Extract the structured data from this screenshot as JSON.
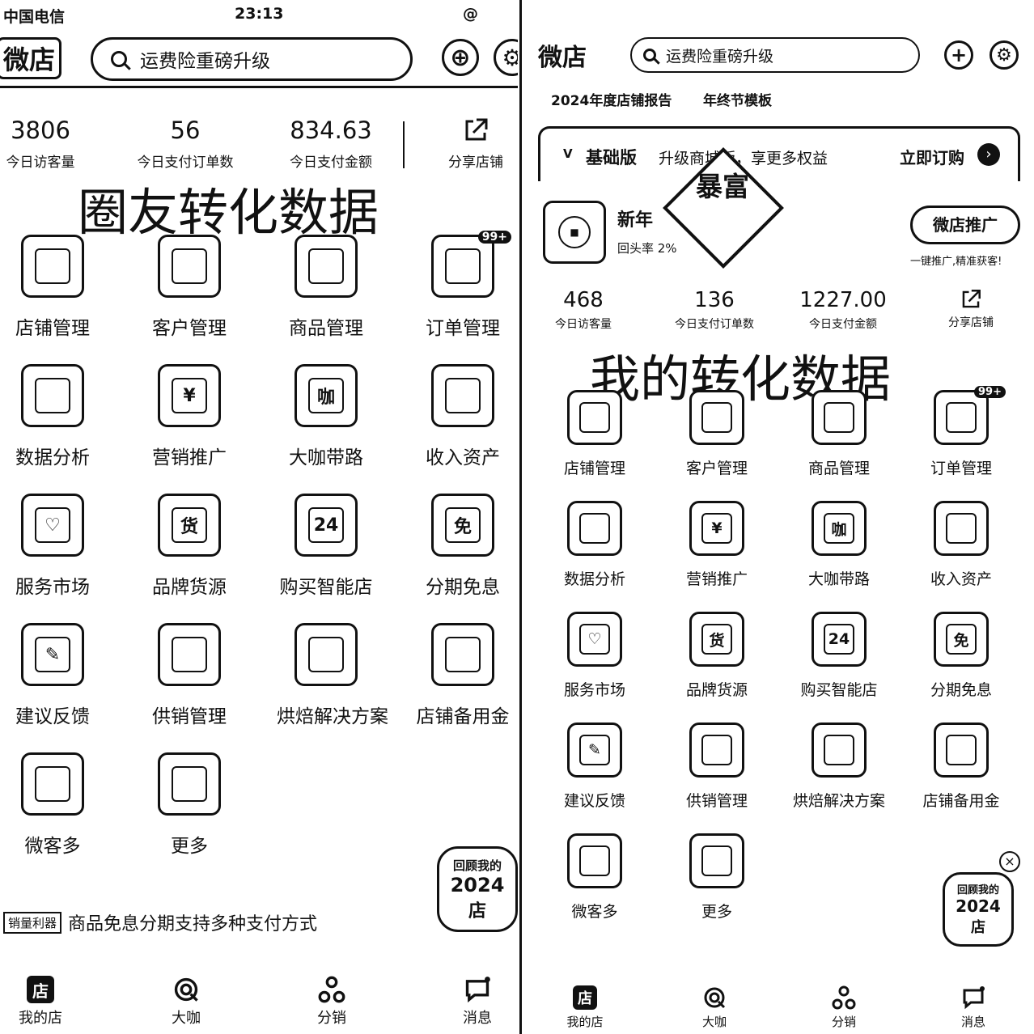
{
  "left": {
    "status": {
      "carrier": "中国电信",
      "time": "23:13",
      "right_icons": "@"
    },
    "header": {
      "logo": "微店",
      "search_placeholder": "运费险重磅升级"
    },
    "stats": [
      {
        "value": "3806",
        "label": "今日访客量"
      },
      {
        "value": "56",
        "label": "今日支付订单数"
      },
      {
        "value": "834.63",
        "label": "今日支付金额"
      }
    ],
    "share_label": "分享店铺",
    "overlay_title": "圈友转化数据",
    "grid": [
      {
        "label": "店铺管理",
        "glyph": ""
      },
      {
        "label": "客户管理",
        "glyph": ""
      },
      {
        "label": "商品管理",
        "glyph": ""
      },
      {
        "label": "订单管理",
        "glyph": "",
        "badge": "99+"
      },
      {
        "label": "数据分析",
        "glyph": ""
      },
      {
        "label": "营销推广",
        "glyph": "¥"
      },
      {
        "label": "大咖带路",
        "glyph": "咖"
      },
      {
        "label": "收入资产",
        "glyph": ""
      },
      {
        "label": "服务市场",
        "glyph": "♡"
      },
      {
        "label": "品牌货源",
        "glyph": "货"
      },
      {
        "label": "购买智能店",
        "glyph": "24"
      },
      {
        "label": "分期免息",
        "glyph": "免"
      },
      {
        "label": "建议反馈",
        "glyph": "✎"
      },
      {
        "label": "供销管理",
        "glyph": ""
      },
      {
        "label": "烘焙解决方案",
        "glyph": ""
      },
      {
        "label": "店铺备用金",
        "glyph": ""
      },
      {
        "label": "微客多",
        "glyph": ""
      },
      {
        "label": "更多",
        "glyph": ""
      }
    ],
    "promo_tag": "销量利器",
    "promo_text": "商品免息分期支持多种支付方式",
    "float_badge": [
      "回顾我的",
      "2024",
      "店"
    ],
    "tabs": [
      {
        "label": "我的店",
        "icon": "店"
      },
      {
        "label": "大咖",
        "icon": ""
      },
      {
        "label": "分销",
        "icon": ""
      },
      {
        "label": "消息",
        "icon": ""
      }
    ]
  },
  "right": {
    "header": {
      "logo": "微店",
      "search_placeholder": "运费险重磅升级"
    },
    "sub_banner": [
      "2024年度店铺报告",
      "年终节模板"
    ],
    "upgrade": {
      "tier": "基础版",
      "text": "升级商城版，享更多权益",
      "cta": "立即订购"
    },
    "shop": {
      "name": "新年",
      "repeat_rate": "回头率 2%",
      "promo_button": "微店推广",
      "promo_sub": "一键推广,精准获客!"
    },
    "stamp_text": "暴富",
    "stats": [
      {
        "value": "468",
        "label": "今日访客量"
      },
      {
        "value": "136",
        "label": "今日支付订单数"
      },
      {
        "value": "1227.00",
        "label": "今日支付金额"
      }
    ],
    "share_label": "分享店铺",
    "overlay_title": "我的转化数据",
    "grid": [
      {
        "label": "店铺管理",
        "glyph": ""
      },
      {
        "label": "客户管理",
        "glyph": ""
      },
      {
        "label": "商品管理",
        "glyph": ""
      },
      {
        "label": "订单管理",
        "glyph": "",
        "badge": "99+"
      },
      {
        "label": "数据分析",
        "glyph": ""
      },
      {
        "label": "营销推广",
        "glyph": "¥"
      },
      {
        "label": "大咖带路",
        "glyph": "咖"
      },
      {
        "label": "收入资产",
        "glyph": ""
      },
      {
        "label": "服务市场",
        "glyph": "♡"
      },
      {
        "label": "品牌货源",
        "glyph": "货"
      },
      {
        "label": "购买智能店",
        "glyph": "24"
      },
      {
        "label": "分期免息",
        "glyph": "免"
      },
      {
        "label": "建议反馈",
        "glyph": "✎"
      },
      {
        "label": "供销管理",
        "glyph": ""
      },
      {
        "label": "烘焙解决方案",
        "glyph": ""
      },
      {
        "label": "店铺备用金",
        "glyph": ""
      },
      {
        "label": "微客多",
        "glyph": ""
      },
      {
        "label": "更多",
        "glyph": ""
      }
    ],
    "float_badge": [
      "回顾我的",
      "2024",
      "店"
    ],
    "tabs": [
      {
        "label": "我的店",
        "icon": "店"
      },
      {
        "label": "大咖",
        "icon": ""
      },
      {
        "label": "分销",
        "icon": ""
      },
      {
        "label": "消息",
        "icon": ""
      }
    ]
  }
}
